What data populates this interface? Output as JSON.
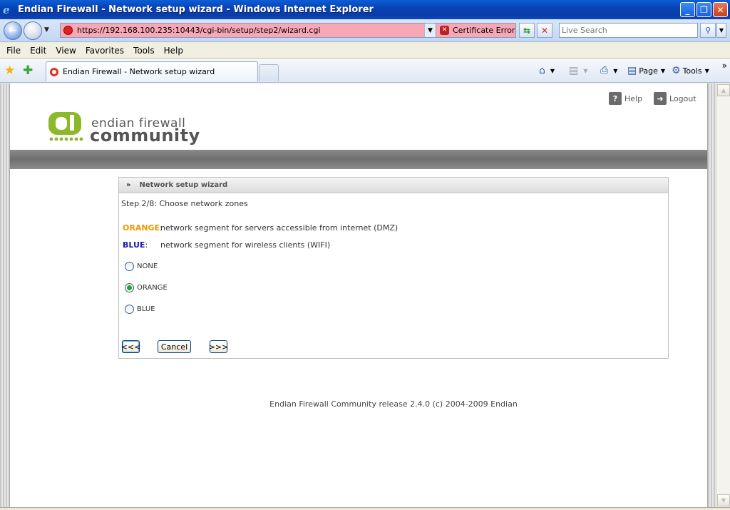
{
  "window": {
    "title": "Endian Firewall - Network setup wizard - Windows Internet Explorer",
    "controls": {
      "minimize": "_",
      "maximize": "❐",
      "close": "✕"
    }
  },
  "addressbar": {
    "url": "https://192.168.100.235:10443/cgi-bin/setup/step2/wizard.cgi",
    "cert_error": "Certificate Error",
    "search_placeholder": "Live Search"
  },
  "menu": [
    "File",
    "Edit",
    "View",
    "Favorites",
    "Tools",
    "Help"
  ],
  "tabs": {
    "active_label": "Endian Firewall - Network setup wizard"
  },
  "commandbar": {
    "page_label": "Page",
    "tools_label": "Tools"
  },
  "header": {
    "help_label": "Help",
    "logout_label": "Logout",
    "logo_line1": "endian firewall",
    "logo_line2": "community"
  },
  "wizard": {
    "panel_title": "Network setup wizard",
    "step_text": "Step 2/8: Choose network zones",
    "zones": [
      {
        "name": "ORANGE",
        "suffix": ":",
        "description": "network segment for servers accessible from internet (DMZ)"
      },
      {
        "name": "BLUE",
        "suffix": ":",
        "description": "network segment for wireless clients (WIFI)"
      }
    ],
    "options": [
      {
        "label": "NONE",
        "selected": false
      },
      {
        "label": "ORANGE",
        "selected": true
      },
      {
        "label": "BLUE",
        "selected": false
      }
    ],
    "buttons": {
      "back": "<<<",
      "cancel": "Cancel",
      "next": ">>>"
    }
  },
  "footer": {
    "text": "Endian Firewall Community release 2.4.0 (c) 2004-2009 Endian"
  },
  "colors": {
    "orange_zone": "#e89a00",
    "blue_zone": "#1a1aa8",
    "logo_green": "#8cb82a",
    "address_error_bg": "#f8a8b4"
  }
}
